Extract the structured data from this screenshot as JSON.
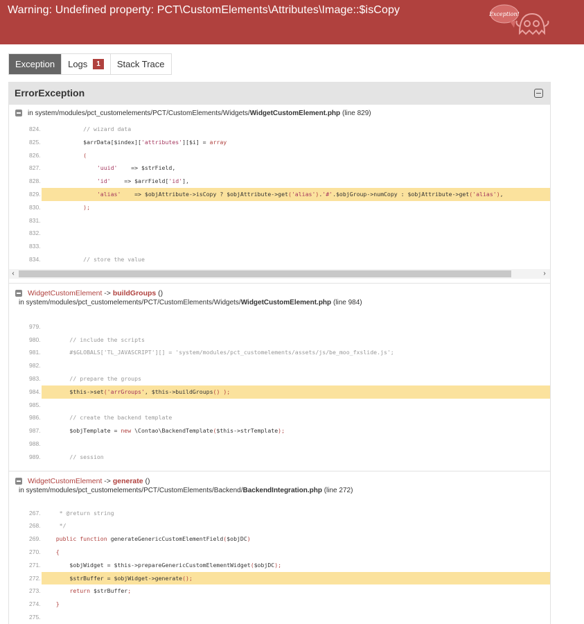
{
  "header": {
    "title": "Warning: Undefined property: PCT\\CustomElements\\Attributes\\Image::$isCopy",
    "logo_text": "Exception!"
  },
  "tabs": [
    {
      "label": "Exception"
    },
    {
      "label": "Logs",
      "badge": "1"
    },
    {
      "label": "Stack Trace"
    }
  ],
  "panel": {
    "title": "ErrorException"
  },
  "frames": [
    {
      "in": "in",
      "path": "system/modules/pct_customelements/PCT/CustomElements/Widgets/",
      "file": "WidgetCustomElement.php",
      "line_info": "(line 829)",
      "lines": [
        {
          "n": "824.",
          "code": "            // wizard data"
        },
        {
          "n": "825.",
          "code": "            $arrData[$index]['attributes'][$i] = array"
        },
        {
          "n": "826.",
          "code": "            ("
        },
        {
          "n": "827.",
          "code": "                'uuid'    => $strField,"
        },
        {
          "n": "828.",
          "code": "                'id'    => $arrField['id'],"
        },
        {
          "n": "829.",
          "code": "                'alias'    => $objAttribute->isCopy ? $objAttribute->get('alias').'#'.$objGroup->numCopy : $objAttribute->get('alias'),"
        },
        {
          "n": "830.",
          "code": "            );"
        },
        {
          "n": "831.",
          "code": ""
        },
        {
          "n": "832.",
          "code": ""
        },
        {
          "n": "833.",
          "code": ""
        },
        {
          "n": "834.",
          "code": "            // store the value"
        }
      ]
    },
    {
      "class": "WidgetCustomElement",
      "arrow": " -> ",
      "function": "buildGroups",
      "paren": " ()",
      "in": "in",
      "path": "system/modules/pct_customelements/PCT/CustomElements/Widgets/",
      "file": "WidgetCustomElement.php",
      "line_info": "(line 984)",
      "lines": [
        {
          "n": "979.",
          "code": ""
        },
        {
          "n": "980.",
          "code": "        // include the scripts"
        },
        {
          "n": "981.",
          "code": "        #$GLOBALS['TL_JAVASCRIPT'][] = 'system/modules/pct_customelements/assets/js/be_moo_fxslide.js';"
        },
        {
          "n": "982.",
          "code": ""
        },
        {
          "n": "983.",
          "code": "        // prepare the groups"
        },
        {
          "n": "984.",
          "code": "        $this->set('arrGroups', $this->buildGroups() );"
        },
        {
          "n": "985.",
          "code": ""
        },
        {
          "n": "986.",
          "code": "        // create the backend template"
        },
        {
          "n": "987.",
          "code": "        $objTemplate = new \\Contao\\BackendTemplate($this->strTemplate);"
        },
        {
          "n": "988.",
          "code": ""
        },
        {
          "n": "989.",
          "code": "        // session"
        }
      ]
    },
    {
      "class": "WidgetCustomElement",
      "arrow": " -> ",
      "function": "generate",
      "paren": " ()",
      "in": "in",
      "path": "system/modules/pct_customelements/PCT/CustomElements/Backend/",
      "file": "BackendIntegration.php",
      "line_info": "(line 272)",
      "lines": [
        {
          "n": "267.",
          "code": "     * @return string"
        },
        {
          "n": "268.",
          "code": "     */"
        },
        {
          "n": "269.",
          "code": "    public function generateGenericCustomElementField($objDC)"
        },
        {
          "n": "270.",
          "code": "    {"
        },
        {
          "n": "271.",
          "code": "        $objWidget = $this->prepareGenericCustomElementWidget($objDC);"
        },
        {
          "n": "272.",
          "code": "        $strBuffer = $objWidget->generate();"
        },
        {
          "n": "273.",
          "code": "        return $strBuffer;"
        },
        {
          "n": "274.",
          "code": "    }"
        },
        {
          "n": "275.",
          "code": ""
        }
      ]
    }
  ],
  "colors": {
    "header_bg": "#b0413e",
    "highlight": "#fbe29d",
    "tab_active": "#666666"
  }
}
